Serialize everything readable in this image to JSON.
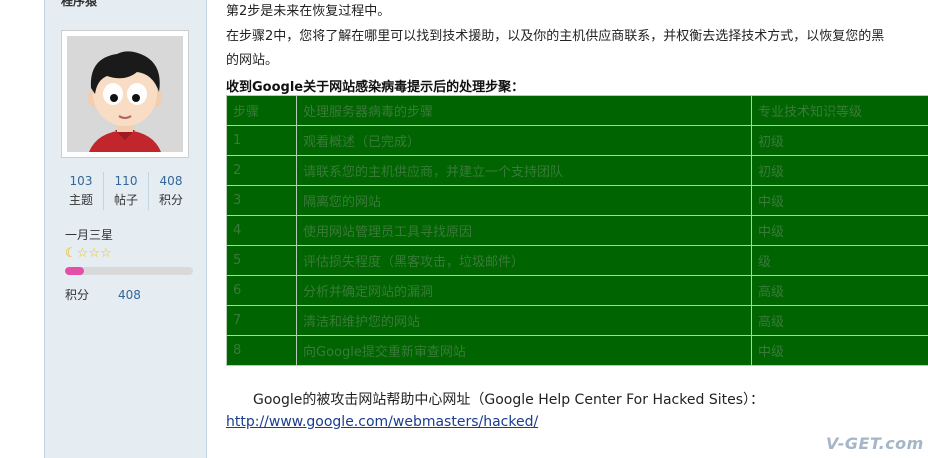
{
  "sidebar": {
    "username": "程序猿",
    "stats": [
      {
        "value": "103",
        "label": "主题"
      },
      {
        "value": "110",
        "label": "帖子"
      },
      {
        "value": "408",
        "label": "积分"
      }
    ],
    "rank": "一月三星",
    "level_progress": 0.15,
    "points_label": "积分",
    "points_value": "408"
  },
  "content": {
    "line1": "第2步是未来在恢复过程中。",
    "line2": "在步骤2中，您将了解在哪里可以找到技术援助，以及你的主机供应商联系，并权衡去选择技术方式，以恢复您的黑",
    "line3": "的网站。",
    "heading": "收到Google关于网站感染病毒提示后的处理步聚：",
    "table": {
      "headers": [
        "步骤",
        "处理服务器病毒的步骤",
        "专业技术知识等级"
      ],
      "rows": [
        [
          "1",
          "观看概述（已完成）",
          "初级"
        ],
        [
          "2",
          "请联系您的主机供应商，并建立一个支持团队",
          "初级"
        ],
        [
          "3",
          "隔离您的网站",
          "中级"
        ],
        [
          "4",
          "使用网站管理员工具寻找原因",
          "中级"
        ],
        [
          "5",
          "评估损失程度（黑客攻击，垃圾邮件）",
          "级"
        ],
        [
          "6",
          "分析并确定网站的漏洞",
          "高级"
        ],
        [
          "7",
          "清洁和维护您的网站",
          "高级"
        ],
        [
          "8",
          "向Google提交重新审查网站",
          "中级"
        ]
      ]
    },
    "footer_text": "Google的被攻击网站帮助中心网址（Google Help Center For Hacked Sites）：",
    "link": "http://www.google.com/webmasters/hacked/"
  },
  "watermark": "V-GET.com",
  "colors": {
    "table_bg": "#006400",
    "sidebar_bg": "#e5edf2",
    "progress_fill": "#e34fa8",
    "link": "#1a3d8f"
  }
}
